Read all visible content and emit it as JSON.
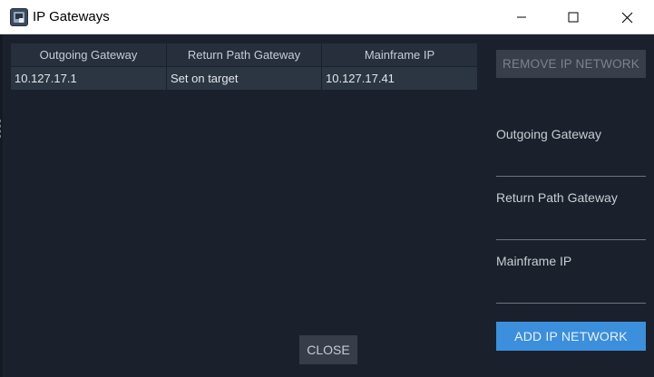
{
  "window": {
    "title": "IP Gateways",
    "app_icon": "app-window-icon",
    "controls": [
      "minimize-icon",
      "maximize-icon",
      "close-icon"
    ]
  },
  "table": {
    "headers": [
      "Outgoing Gateway",
      "Return Path Gateway",
      "Mainframe IP"
    ],
    "rows": [
      [
        "10.127.17.1",
        "Set on target",
        "10.127.17.41"
      ]
    ]
  },
  "side_panel": {
    "remove_button": "REMOVE IP NETWORK",
    "outgoing_gateway_label": "Outgoing Gateway",
    "outgoing_gateway_value": "",
    "return_path_gateway_label": "Return Path Gateway",
    "return_path_gateway_value": "",
    "mainframe_ip_label": "Mainframe IP",
    "mainframe_ip_value": "",
    "add_button": "ADD IP NETWORK"
  },
  "footer": {
    "close_button": "CLOSE"
  },
  "colors": {
    "background": "#1b212c",
    "header_cell": "#262f3b",
    "row_cell": "#2c3542",
    "accent_button": "#3b8fdc",
    "disabled_button": "#383f4a"
  }
}
